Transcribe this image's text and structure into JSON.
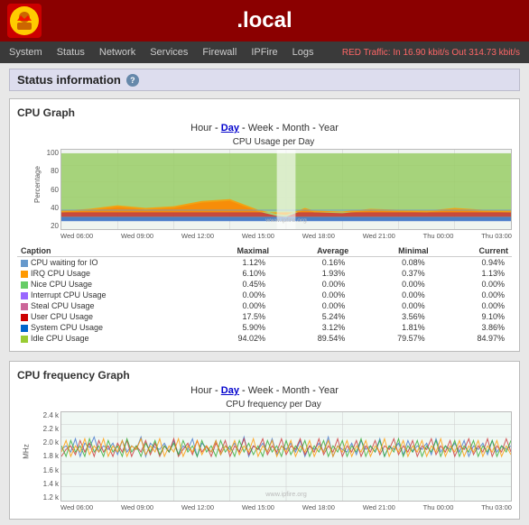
{
  "header": {
    "title": ".local",
    "logo_alt": "IPFire Logo"
  },
  "navbar": {
    "items": [
      {
        "label": "System",
        "href": "#"
      },
      {
        "label": "Status",
        "href": "#"
      },
      {
        "label": "Network",
        "href": "#"
      },
      {
        "label": "Services",
        "href": "#"
      },
      {
        "label": "Firewall",
        "href": "#"
      },
      {
        "label": "IPFire",
        "href": "#"
      },
      {
        "label": "Logs",
        "href": "#"
      }
    ],
    "traffic": "RED Traffic: In 16.90 kbit/s  Out 314.73 kbit/s"
  },
  "page": {
    "title": "Status information"
  },
  "cpu_graph": {
    "section_title": "CPU Graph",
    "chart_title": "CPU Usage per Day",
    "time_nav": [
      "Hour",
      "Day",
      "Week",
      "Month",
      "Year"
    ],
    "time_active": "Day",
    "y_axis_label": "Percentage",
    "y_axis_values": [
      "100",
      "80",
      "60",
      "40",
      "20"
    ],
    "x_axis_values": [
      "Wed 06:00",
      "Wed 09:00",
      "Wed 12:00",
      "Wed 15:00",
      "Wed 18:00",
      "Wed 21:00",
      "Thu 00:00",
      "Thu 03:00"
    ],
    "watermark": "www.ipfire.org",
    "legend_headers": [
      "Caption",
      "Maximal",
      "Average",
      "Minimal",
      "Current"
    ],
    "legend_rows": [
      {
        "color": "#6699cc",
        "label": "CPU waiting for IO",
        "max": "1.12%",
        "avg": "0.16%",
        "min": "0.08%",
        "cur": "0.94%"
      },
      {
        "color": "#ff9900",
        "label": "IRQ CPU Usage",
        "max": "6.10%",
        "avg": "1.93%",
        "min": "0.37%",
        "cur": "1.13%"
      },
      {
        "color": "#66cc66",
        "label": "Nice CPU Usage",
        "max": "0.45%",
        "avg": "0.00%",
        "min": "0.00%",
        "cur": "0.00%"
      },
      {
        "color": "#9966ff",
        "label": "Interrupt CPU Usage",
        "max": "0.00%",
        "avg": "0.00%",
        "min": "0.00%",
        "cur": "0.00%"
      },
      {
        "color": "#cc6699",
        "label": "Steal CPU Usage",
        "max": "0.00%",
        "avg": "0.00%",
        "min": "0.00%",
        "cur": "0.00%"
      },
      {
        "color": "#cc0000",
        "label": "User CPU Usage",
        "max": "17.5%",
        "avg": "5.24%",
        "min": "3.56%",
        "cur": "9.10%"
      },
      {
        "color": "#0066cc",
        "label": "System CPU Usage",
        "max": "5.90%",
        "avg": "3.12%",
        "min": "1.81%",
        "cur": "3.86%"
      },
      {
        "color": "#99cc33",
        "label": "Idle CPU Usage",
        "max": "94.02%",
        "avg": "89.54%",
        "min": "79.57%",
        "cur": "84.97%"
      }
    ]
  },
  "cpu_freq_graph": {
    "section_title": "CPU frequency Graph",
    "chart_title": "CPU frequency per Day",
    "time_nav": [
      "Hour",
      "Day",
      "Week",
      "Month",
      "Year"
    ],
    "time_active": "Day",
    "y_axis_label": "MHz",
    "y_axis_values": [
      "2.4 k",
      "2.2 k",
      "2.0 k",
      "1.8 k",
      "1.6 k",
      "1.4 k",
      "1.2 k"
    ]
  }
}
